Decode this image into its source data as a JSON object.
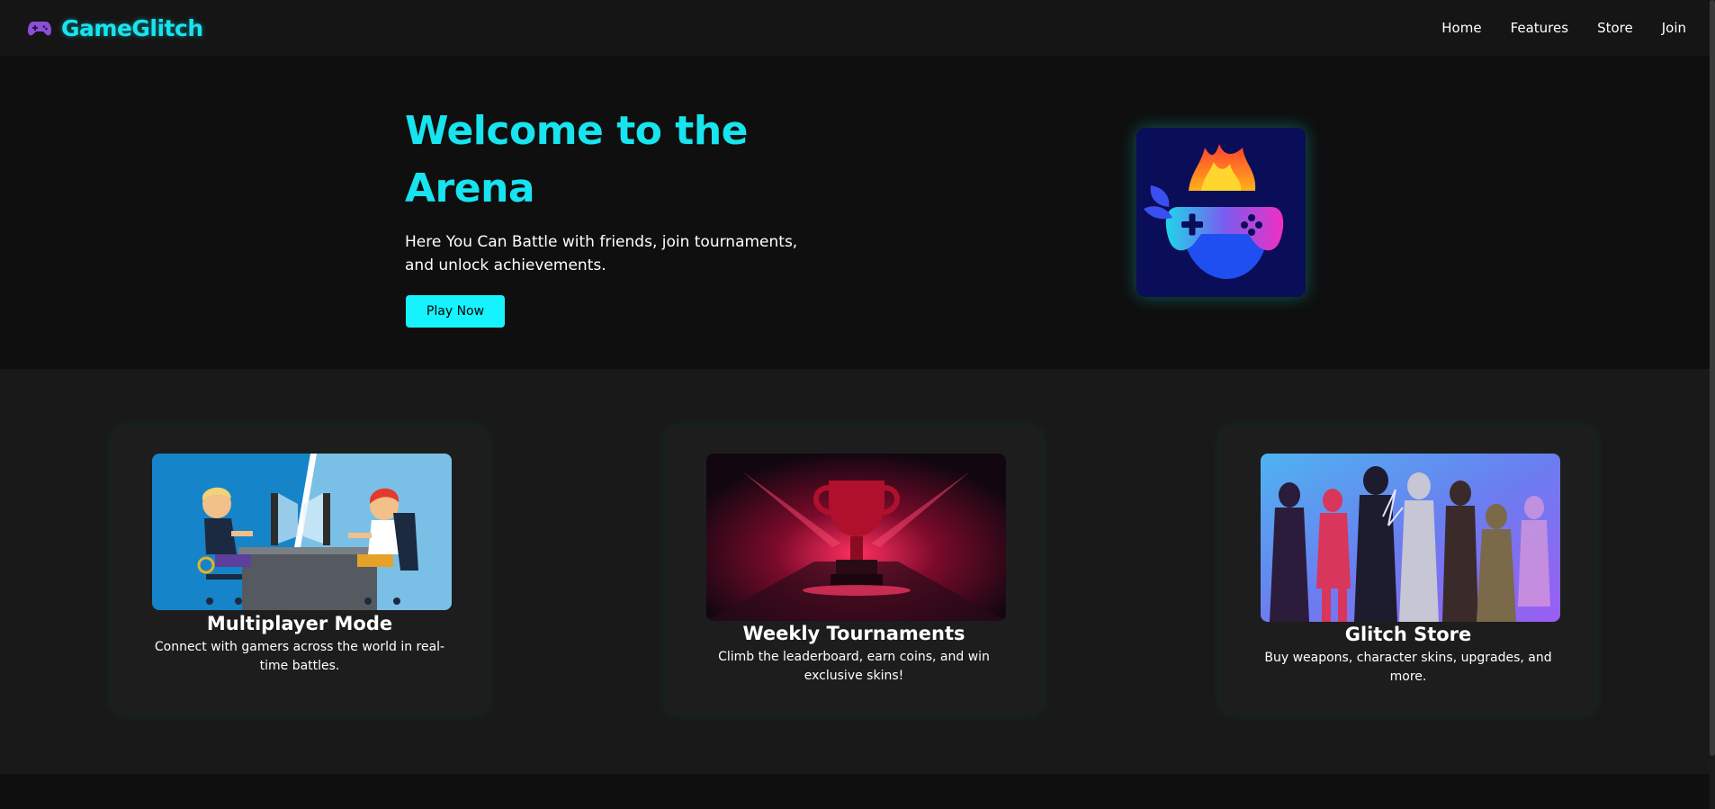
{
  "nav": {
    "brand": "GameGlitch",
    "links": [
      "Home",
      "Features",
      "Store",
      "Join"
    ]
  },
  "hero": {
    "title": "Welcome to the Arena",
    "subtitle": "Here You Can Battle with friends, join tournaments, and unlock achievements.",
    "cta_label": "Play Now"
  },
  "features": [
    {
      "title": "Multiplayer Mode",
      "description": "Connect with gamers across the world in real-time battles.",
      "image": "two-gamers-at-computers-illustration"
    },
    {
      "title": "Weekly Tournaments",
      "description": "Climb the leaderboard, earn coins, and win exclusive skins!",
      "image": "trophy-on-red-stage-illustration"
    },
    {
      "title": "Glitch Store",
      "description": "Buy weapons, character skins, upgrades, and more.",
      "image": "game-characters-lineup-illustration"
    }
  ],
  "icons": {
    "brand": "gamepad-icon",
    "hero_logo": "flaming-gamepad-logo"
  },
  "colors": {
    "accent": "#17e4ef",
    "button": "#17f2ff",
    "background": "#0f0f0f",
    "navbar": "#151515",
    "section": "#191919",
    "card": "#1d1d1d"
  }
}
